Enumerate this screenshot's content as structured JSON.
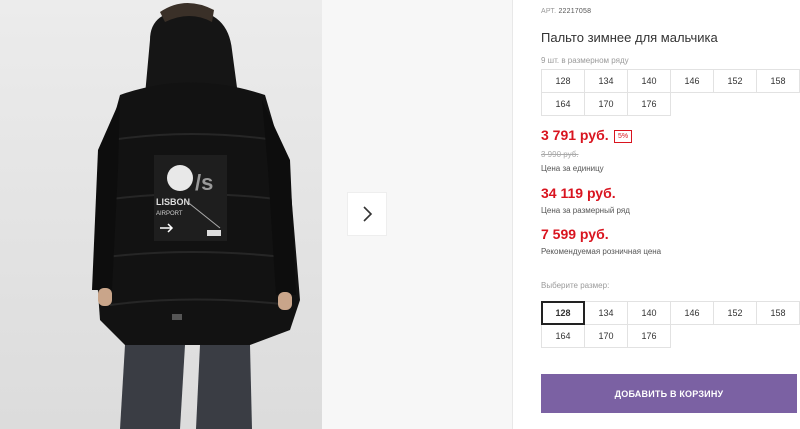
{
  "product": {
    "sku_label": "АРТ.",
    "sku": "22217058",
    "title": "Пальто зимнее для мальчика",
    "range_label": "9 шт. в размерном ряду",
    "range_sizes": [
      "128",
      "134",
      "140",
      "146",
      "152",
      "158",
      "164",
      "170",
      "176"
    ]
  },
  "pricing": {
    "price": "3 791 руб.",
    "discount": "5%",
    "old_price": "3 990 руб.",
    "unit_label": "Цена за единицу",
    "range_price": "34 119 руб.",
    "range_price_label": "Цена за размерный ряд",
    "retail_price": "7 599 руб.",
    "retail_label": "Рекомендуемая розничная цена"
  },
  "size_select": {
    "label": "Выберите размер:",
    "options": [
      "128",
      "134",
      "140",
      "146",
      "152",
      "158",
      "164",
      "170",
      "176"
    ],
    "selected": "128"
  },
  "cart": {
    "add_label": "ДОБАВИТЬ В КОРЗИНУ"
  },
  "gallery": {
    "next_icon": "chevron-right-icon",
    "patch_text_1": "LISBON",
    "patch_text_2": "AIRPORT"
  },
  "colors": {
    "price_red": "#d9141f",
    "button_purple": "#7b61a3"
  }
}
